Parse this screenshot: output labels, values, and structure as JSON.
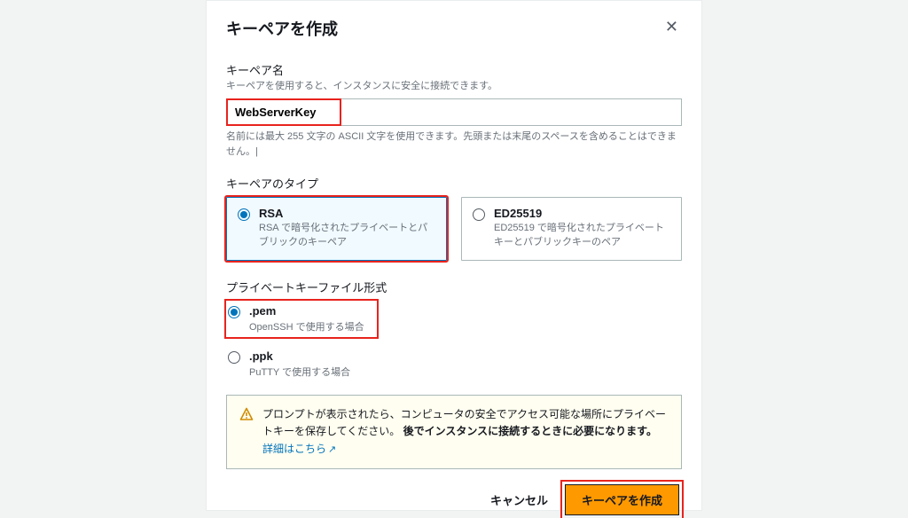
{
  "modal": {
    "title": "キーペアを作成"
  },
  "name": {
    "label": "キーペア名",
    "desc": "キーペアを使用すると、インスタンスに安全に接続できます。",
    "value": "WebServerKey",
    "helper": "名前には最大 255 文字の ASCII 文字を使用できます。先頭または末尾のスペースを含めることはできません。|"
  },
  "type": {
    "label": "キーペアのタイプ",
    "options": [
      {
        "title": "RSA",
        "desc": "RSA で暗号化されたプライベートとパブリックのキーペア",
        "selected": true
      },
      {
        "title": "ED25519",
        "desc": "ED25519 で暗号化されたプライベートキーとパブリックキーのペア",
        "selected": false
      }
    ]
  },
  "format": {
    "label": "プライベートキーファイル形式",
    "options": [
      {
        "title": ".pem",
        "desc": "OpenSSH で使用する場合",
        "selected": true
      },
      {
        "title": ".ppk",
        "desc": "PuTTY で使用する場合",
        "selected": false
      }
    ]
  },
  "alert": {
    "text1": "プロンプトが表示されたら、コンピュータの安全でアクセス可能な場所にプライベートキーを保存してください。",
    "bold": "後でインスタンスに接続するときに必要になります。",
    "link": "詳細はこちら"
  },
  "footer": {
    "cancel": "キャンセル",
    "create": "キーペアを作成"
  }
}
